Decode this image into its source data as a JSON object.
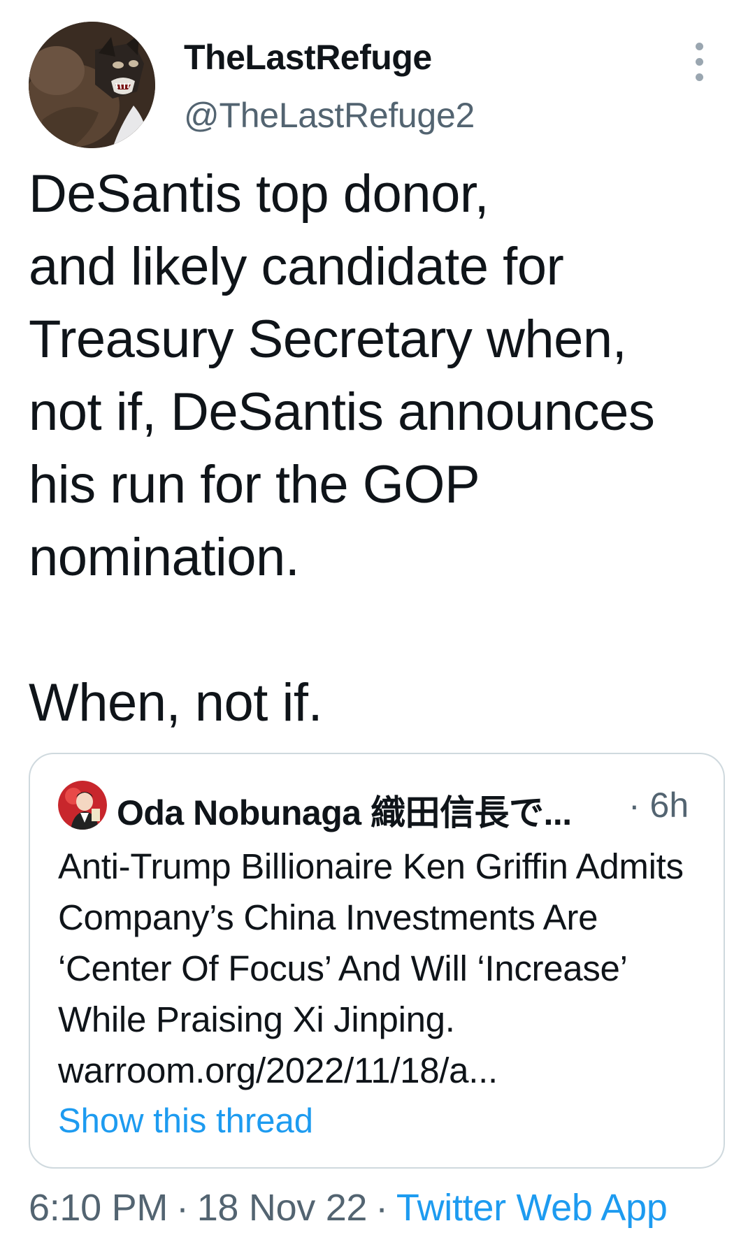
{
  "tweet": {
    "author_name": "TheLastRefuge",
    "author_handle": "@TheLastRefuge2",
    "text": "DeSantis top donor,\nand likely candidate for\nTreasury Secretary when,\nnot if, DeSantis announces\nhis run for the GOP\nnomination.\n\nWhen, not if.",
    "time": "6:10 PM",
    "date": "18 Nov 22",
    "source": "Twitter Web App",
    "separator": "·",
    "more_icon": "more-vertical-icon"
  },
  "quote": {
    "author_name": "Oda Nobunaga 織田信長で...",
    "time": "· 6h",
    "text": "Anti-Trump Billionaire Ken Griffin Admits Company’s China Investments Are ‘Center Of Focus’ And Will ‘Increase’ While Praising Xi Jinping. warroom.org/2022/11/18/a...",
    "show_thread": "Show this thread"
  },
  "colors": {
    "text_primary": "#0f1419",
    "text_secondary": "#536471",
    "link": "#1d9bf0",
    "border": "#cfd9de"
  }
}
